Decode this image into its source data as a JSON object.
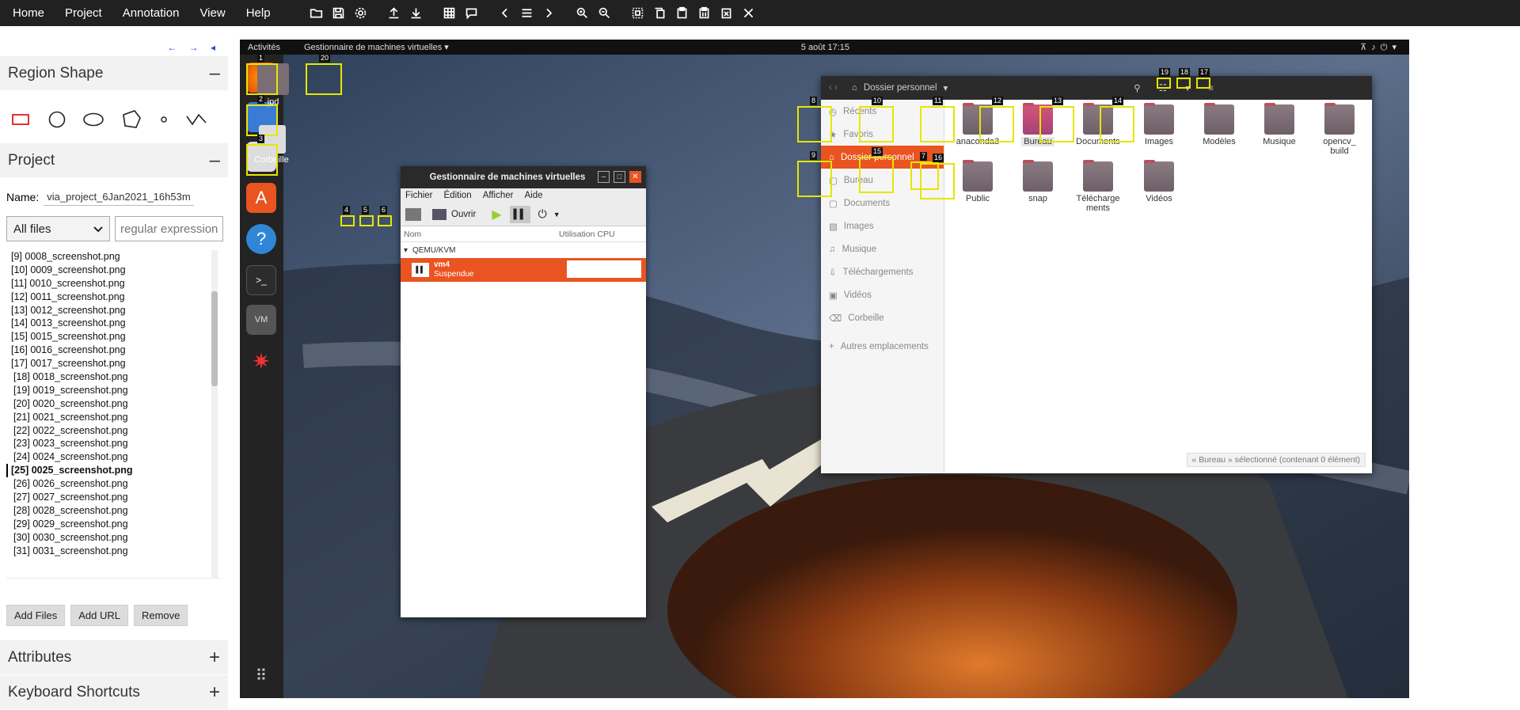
{
  "app": {
    "menu": [
      "Home",
      "Project",
      "Annotation",
      "View",
      "Help"
    ]
  },
  "toolbar_icons": [
    "folder-open-icon",
    "save-icon",
    "gear-icon",
    "upload-icon",
    "download-icon",
    "grid-icon",
    "comment-icon",
    "chevron-left-icon",
    "list-icon",
    "chevron-right-icon",
    "zoom-in-icon",
    "zoom-out-icon",
    "select-all-icon",
    "copy-icon",
    "paste-icon",
    "paste-n-icon",
    "delete-region-icon",
    "close-icon"
  ],
  "leftpanel": {
    "nav_arrows": "← → ◂",
    "region_shape": {
      "title": "Region Shape",
      "toggle": "–"
    },
    "shapes": [
      "rectangle",
      "circle",
      "ellipse",
      "polygon",
      "point",
      "polyline"
    ],
    "project": {
      "title": "Project",
      "toggle": "–",
      "name_label": "Name:",
      "name_value": "via_project_6Jan2021_16h53m",
      "filter_value": "All files",
      "regex_placeholder": "regular expression"
    },
    "files": [
      "[9] 0008_screenshot.png",
      "[10] 0009_screenshot.png",
      "[11] 0010_screenshot.png",
      "[12] 0011_screenshot.png",
      "[13] 0012_screenshot.png",
      "[14] 0013_screenshot.png",
      "[15] 0015_screenshot.png",
      "[16] 0016_screenshot.png",
      "[17] 0017_screenshot.png",
      "[18] 0018_screenshot.png",
      "[19] 0019_screenshot.png",
      "[20] 0020_screenshot.png",
      "[21] 0021_screenshot.png",
      "[22] 0022_screenshot.png",
      "[23] 0023_screenshot.png",
      "[24] 0024_screenshot.png",
      "[25] 0025_screenshot.png",
      "[26] 0026_screenshot.png",
      "[27] 0027_screenshot.png",
      "[28] 0028_screenshot.png",
      "[29] 0029_screenshot.png",
      "[30] 0030_screenshot.png",
      "[31] 0031_screenshot.png"
    ],
    "current_file_index": 16,
    "buttons": {
      "add_files": "Add Files",
      "add_url": "Add URL",
      "remove": "Remove"
    },
    "attributes": {
      "title": "Attributes",
      "toggle": "+"
    },
    "shortcuts": {
      "title": "Keyboard Shortcuts",
      "toggle": "+"
    }
  },
  "screenshot": {
    "gnome": {
      "activities": "Activités",
      "app_menu": "Gestionnaire de machines virtuelles ▾",
      "clock": "5 août  17:15"
    },
    "desktop_icons": {
      "jpd": "jpd",
      "trash": "Corbeille"
    },
    "vm_manager": {
      "title": "Gestionnaire de machines virtuelles",
      "menu": [
        "Fichier",
        "Édition",
        "Afficher",
        "Aide"
      ],
      "open": "Ouvrir",
      "col_name": "Nom",
      "col_cpu": "Utilisation CPU",
      "group": "QEMU/KVM",
      "vm_name": "vm4",
      "vm_state": "Suspendue"
    },
    "file_manager": {
      "location": "Dossier personnel",
      "sidebar": [
        "Récents",
        "Favoris",
        "Dossier personnel",
        "Bureau",
        "Documents",
        "Images",
        "Musique",
        "Téléchargements",
        "Vidéos",
        "Corbeille",
        "Autres emplacements"
      ],
      "folders": [
        "anaconda3",
        "Bureau",
        "Documents",
        "Images",
        "Modèles",
        "Musique",
        "opencv_\nbuild",
        "Public",
        "snap",
        "Télécharge\nments",
        "Vidéos"
      ],
      "status": "« Bureau » sélectionné  (contenant 0 élément)"
    },
    "labels": [
      "1",
      "2",
      "3",
      "4",
      "5",
      "6",
      "7",
      "8",
      "9",
      "10",
      "11",
      "12",
      "13",
      "14",
      "15",
      "16",
      "17",
      "18",
      "19",
      "20"
    ]
  }
}
